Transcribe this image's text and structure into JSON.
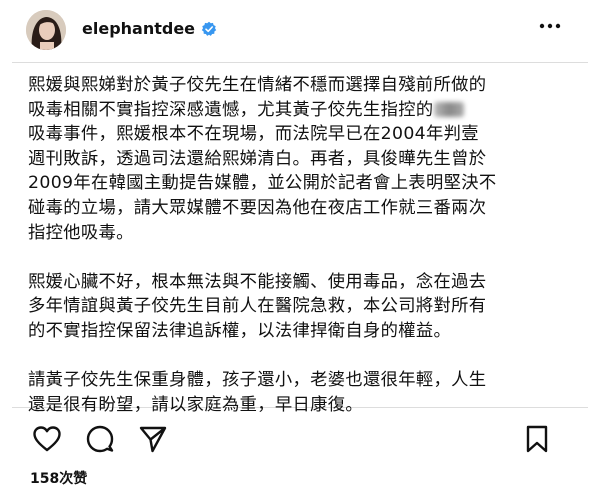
{
  "post": {
    "username": "elephantdee",
    "lines_p1": [
      "熙媛與熙娣對於黃子佼先生在情緒不穩而選擇自殘前所做的",
      "吸毒相關不實指控深感遺憾，尤其黃子佼先生指控的",
      "吸毒事件，熙媛根本不在現場，而法院早已在2004年判壹",
      "週刊敗訴，透過司法還給熙娣清白。再者，具俊曄先生曾於",
      "2009年在韓國主動提告媒體，並公開於記者會上表明堅決不",
      "碰毒的立場，請大眾媒體不要因為他在夜店工作就三番兩次",
      "指控他吸毒。"
    ],
    "lines_p2": [
      "熙媛心臟不好，根本無法與不能接觸、使用毒品，念在過去",
      "多年情誼與黃子佼先生目前人在醫院急救，本公司將對所有",
      "的不實指控保留法律追訴權，以法律捍衛自身的權益。"
    ],
    "lines_p3": [
      "請黃子佼先生保重身體，孩子還小，老婆也還很年輕，人生",
      "還是很有盼望，請以家庭為重，早日康復。"
    ],
    "likes": "158次赞"
  },
  "icons": {
    "verified": "verified-badge-icon",
    "more": "more-options-icon",
    "like": "heart-icon",
    "comment": "comment-icon",
    "share": "send-icon",
    "save": "bookmark-icon"
  },
  "colors": {
    "verified": "#3897f0",
    "text": "#111111"
  }
}
